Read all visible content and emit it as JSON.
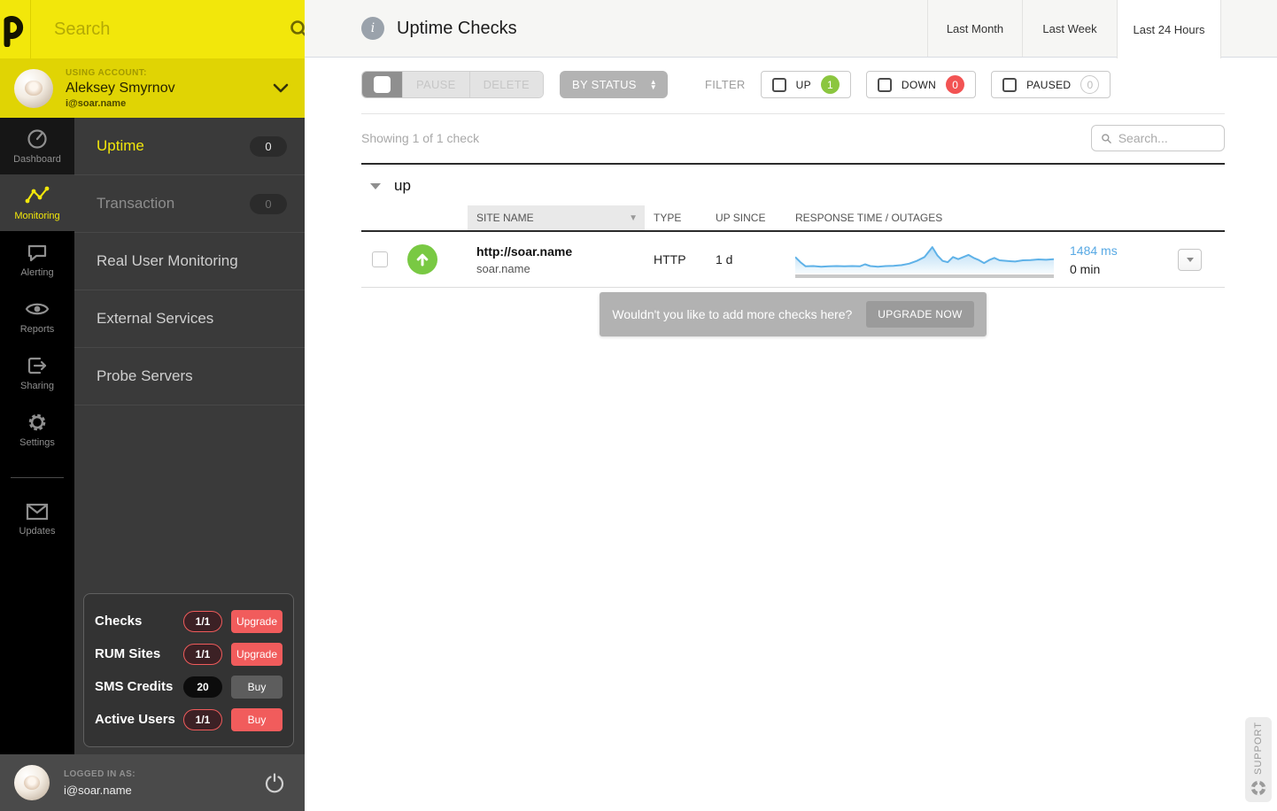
{
  "colors": {
    "brand_yellow": "#f2e70b",
    "account_band_yellow": "#e0d404",
    "sidebar_dark": "#3a3a3a",
    "up_green": "#79c943",
    "badge_green": "#8bc63f",
    "badge_red": "#f25353",
    "upgrade_red": "#f15c5c",
    "spark_blue": "#5fb2e8",
    "response_blue": "#58a9e4"
  },
  "sidebar": {
    "search_placeholder": "Search",
    "account": {
      "label": "USING ACCOUNT:",
      "name": "Aleksey Smyrnov",
      "email": "i@soar.name"
    },
    "rail": {
      "dashboard": "Dashboard",
      "monitoring": "Monitoring",
      "alerting": "Alerting",
      "reports": "Reports",
      "sharing": "Sharing",
      "settings": "Settings",
      "updates": "Updates"
    },
    "menu": [
      {
        "label": "Uptime",
        "badge": "0"
      },
      {
        "label": "Transaction",
        "badge": "0"
      },
      {
        "label": "Real User Monitoring"
      },
      {
        "label": "External Services"
      },
      {
        "label": "Probe Servers"
      }
    ],
    "usage": [
      {
        "label": "Checks",
        "value": "1/1",
        "action": "Upgrade"
      },
      {
        "label": "RUM Sites",
        "value": "1/1",
        "action": "Upgrade"
      },
      {
        "label": "SMS Credits",
        "value": "20",
        "action": "Buy"
      },
      {
        "label": "Active Users",
        "value": "1/1",
        "action": "Buy"
      }
    ],
    "footer": {
      "label": "LOGGED IN AS:",
      "email": "i@soar.name"
    }
  },
  "header": {
    "title": "Uptime Checks",
    "tabs": [
      {
        "label": "Last Month"
      },
      {
        "label": "Last Week"
      },
      {
        "label": "Last 24 Hours"
      }
    ]
  },
  "toolbar": {
    "pause": "PAUSE",
    "delete": "DELETE",
    "by_status": "BY STATUS",
    "filter_label": "FILTER",
    "filters": [
      {
        "label": "UP",
        "count": "1"
      },
      {
        "label": "DOWN",
        "count": "0"
      },
      {
        "label": "PAUSED",
        "count": "0"
      }
    ]
  },
  "listbar": {
    "showing": "Showing 1 of 1 check",
    "search_placeholder": "Search..."
  },
  "group": {
    "title": "up"
  },
  "table": {
    "columns": {
      "site": "SITE NAME",
      "type": "TYPE",
      "since": "UP SINCE",
      "response": "RESPONSE TIME / OUTAGES"
    },
    "rows": [
      {
        "name": "http://soar.name",
        "subtitle": "soar.name",
        "type": "HTTP",
        "up_since": "1 d",
        "response_ms": "1484 ms",
        "outage_min": "0 min",
        "status": "up"
      }
    ]
  },
  "chart_data": {
    "type": "area",
    "title": "Response time last 24 hours (sparkline)",
    "x_range": [
      0,
      100
    ],
    "y_range": [
      0,
      100
    ],
    "line_color": "#5fb2e8",
    "points": [
      [
        0,
        55
      ],
      [
        2,
        38
      ],
      [
        4,
        24
      ],
      [
        7,
        25
      ],
      [
        10,
        23
      ],
      [
        13,
        24
      ],
      [
        16,
        25
      ],
      [
        19,
        24
      ],
      [
        22,
        25
      ],
      [
        25,
        24
      ],
      [
        27,
        31
      ],
      [
        29,
        25
      ],
      [
        32,
        23
      ],
      [
        35,
        25
      ],
      [
        38,
        26
      ],
      [
        41,
        28
      ],
      [
        44,
        33
      ],
      [
        47,
        42
      ],
      [
        50,
        55
      ],
      [
        53,
        88
      ],
      [
        55,
        60
      ],
      [
        57,
        42
      ],
      [
        59,
        38
      ],
      [
        61,
        55
      ],
      [
        63,
        48
      ],
      [
        65,
        55
      ],
      [
        67,
        62
      ],
      [
        69,
        52
      ],
      [
        71,
        45
      ],
      [
        73,
        35
      ],
      [
        75,
        45
      ],
      [
        77,
        52
      ],
      [
        79,
        44
      ],
      [
        82,
        42
      ],
      [
        85,
        40
      ],
      [
        88,
        44
      ],
      [
        91,
        45
      ],
      [
        94,
        47
      ],
      [
        97,
        46
      ],
      [
        100,
        48
      ]
    ]
  },
  "upsell": {
    "text": "Wouldn't you like to add more checks here?",
    "button": "UPGRADE NOW"
  },
  "support": {
    "label": "SUPPORT"
  }
}
